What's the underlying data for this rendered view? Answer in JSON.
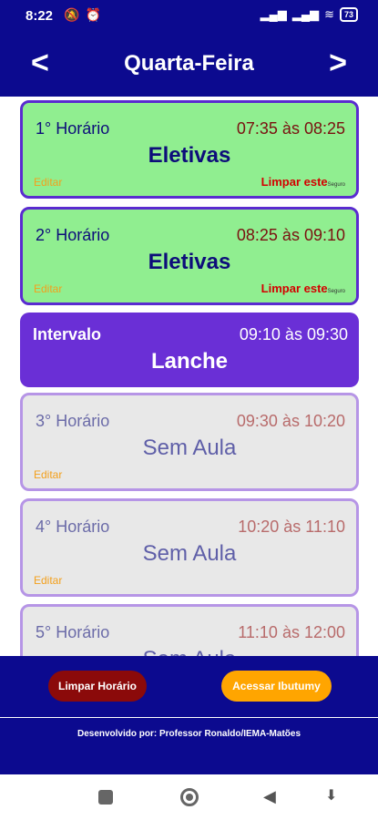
{
  "status": {
    "time": "8:22",
    "left_icons": [
      "notification-off",
      "alarm"
    ],
    "battery": "73"
  },
  "header": {
    "title": "Quarta-Feira",
    "prev": "<",
    "next": ">"
  },
  "cards": [
    {
      "period": "1° Horário",
      "time": "07:35 às 08:25",
      "subject": "Eletivas",
      "edit": "Editar",
      "clear": "Limpar este",
      "clear_small": "Seguro"
    },
    {
      "period": "2° Horário",
      "time": "08:25 às 09:10",
      "subject": "Eletivas",
      "edit": "Editar",
      "clear": "Limpar este",
      "clear_small": "Seguro"
    },
    {
      "period": "Intervalo",
      "time": "09:10 às 09:30",
      "subject": "Lanche"
    },
    {
      "period": "3° Horário",
      "time": "09:30 às 10:20",
      "subject": "Sem Aula",
      "edit": "Editar"
    },
    {
      "period": "4° Horário",
      "time": "10:20 às 11:10",
      "subject": "Sem Aula",
      "edit": "Editar"
    },
    {
      "period": "5° Horário",
      "time": "11:10 às 12:00",
      "subject": "Sem Aula"
    }
  ],
  "footer": {
    "clear_button": "Limpar Horário",
    "access_button": "Acessar Ibutumy",
    "credit": "Desenvolvido por: Professor Ronaldo/IEMA-Matões"
  },
  "colors": {
    "header_bg": "#0c0a8f",
    "active_card": "#90ee90",
    "break_card": "#6a2fd6",
    "empty_card": "#e8e8e8",
    "clear_button": "#8b0a0a",
    "access_button": "#ffa500"
  }
}
